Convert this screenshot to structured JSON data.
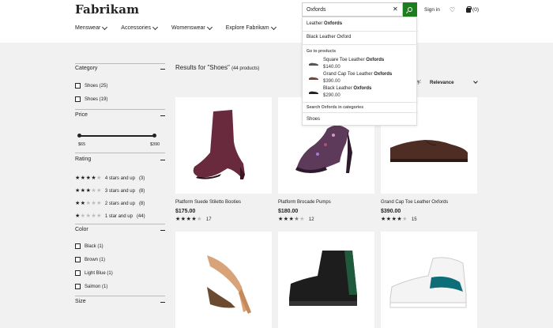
{
  "header": {
    "logo": "Fabrikam",
    "nav": [
      {
        "label": "Menswear"
      },
      {
        "label": "Accessories"
      },
      {
        "label": "Womenswear"
      },
      {
        "label": "Explore Fabrikam"
      }
    ],
    "search_value": "Oxfords",
    "sign_in": "Sign in",
    "cart_count": "(0)"
  },
  "dropdown": {
    "suggestions": [
      {
        "prefix": "Leather ",
        "bold": "Oxfords"
      },
      {
        "prefix": "Black Leather Oxford",
        "bold": ""
      }
    ],
    "go_to_products_heading": "Go to products",
    "products": [
      {
        "prefix": "Square Toe Leather ",
        "bold": "Oxfords",
        "price": "$140.00"
      },
      {
        "prefix": "Grand Cap Toe Leather ",
        "bold": "Oxfords",
        "price": "$390.00"
      },
      {
        "prefix": "Black Leather ",
        "bold": "Oxfords",
        "price": "$290.00"
      }
    ],
    "categories_heading": "Search Oxfords in categories",
    "category": "Shoes"
  },
  "sidebar": {
    "category_heading": "Category",
    "category_options": [
      {
        "label": "Shoes (25)"
      },
      {
        "label": "Shoes (19)"
      }
    ],
    "price_heading": "Price",
    "price_min": "$65",
    "price_max": "$390",
    "rating_heading": "Rating",
    "ratings": [
      {
        "stars": 4,
        "label": "4 stars and up",
        "count": "(3)"
      },
      {
        "stars": 3,
        "label": "3 stars and up",
        "count": "(8)"
      },
      {
        "stars": 2,
        "label": "2 stars and up",
        "count": "(8)"
      },
      {
        "stars": 1,
        "label": "1 star and up",
        "count": "(44)"
      }
    ],
    "color_heading": "Color",
    "colors": [
      {
        "label": "Black (1)"
      },
      {
        "label": "Brown (1)"
      },
      {
        "label": "Light Blue (1)"
      },
      {
        "label": "Salmon (1)"
      }
    ],
    "size_heading": "Size"
  },
  "results": {
    "title": "Results for \"Shoes\"",
    "count": "(44 products)",
    "sort_label": "t by:",
    "sort_value": "Relevance"
  },
  "products": [
    {
      "name": "Platform Suede Stiletto Booties",
      "price": "$175.00",
      "stars": 4,
      "reviews": "17",
      "icon": "bootie"
    },
    {
      "name": "Platform Brocade Pumps",
      "price": "$180.00",
      "stars": 3.5,
      "reviews": "12",
      "icon": "pump"
    },
    {
      "name": "Grand Cap Toe Leather Oxfords",
      "price": "$390.00",
      "stars": 4,
      "reviews": "15",
      "icon": "oxford"
    },
    {
      "name": "",
      "price": "",
      "stars": 0,
      "reviews": "",
      "icon": "tstrap-heel"
    },
    {
      "name": "",
      "price": "",
      "stars": 0,
      "reviews": "",
      "icon": "high-top-sneaker"
    },
    {
      "name": "",
      "price": "",
      "stars": 0,
      "reviews": "",
      "icon": "basketball-sneaker"
    }
  ],
  "colors": {
    "accent": "#1e7d1e",
    "background": "#f1f1f1"
  }
}
